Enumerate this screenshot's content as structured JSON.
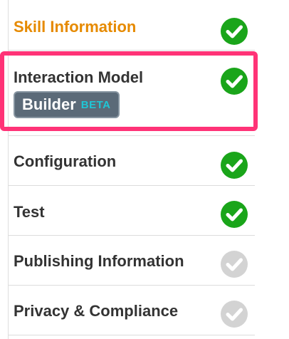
{
  "nav": {
    "items": [
      {
        "label": "Skill Information",
        "status": "complete",
        "active": true
      },
      {
        "label": "Interaction Model",
        "status": "complete",
        "active": false,
        "badge": {
          "label": "Builder",
          "tag": "BETA"
        }
      },
      {
        "label": "Configuration",
        "status": "complete",
        "active": false
      },
      {
        "label": "Test",
        "status": "complete",
        "active": false
      },
      {
        "label": "Publishing Information",
        "status": "incomplete",
        "active": false
      },
      {
        "label": "Privacy & Compliance",
        "status": "incomplete",
        "active": false
      }
    ]
  },
  "colors": {
    "active_text": "#e68a00",
    "text": "#333333",
    "check_complete": "#1aa51a",
    "check_incomplete": "#d3d3d3",
    "highlight": "#ff3377",
    "badge_bg": "#5b6a78",
    "beta_text": "#1fc6d6"
  }
}
